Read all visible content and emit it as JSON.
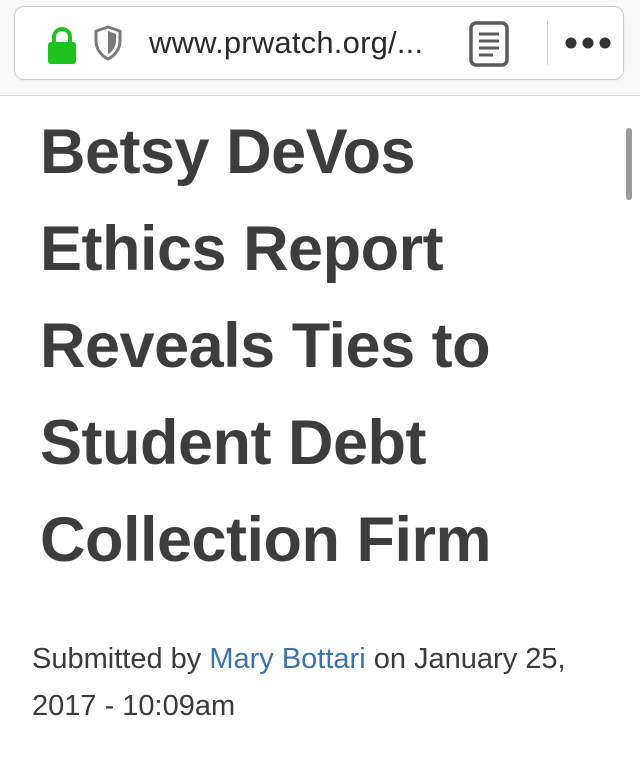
{
  "browser": {
    "url": "www.prwatch.org/...",
    "icons": {
      "lock": "lock-icon",
      "shield": "tracking-protection-shield-icon",
      "reader": "reader-view-icon",
      "more": "more-options-icon"
    },
    "colors": {
      "lock": "#1ec41e",
      "shield": "#7a7a7a"
    }
  },
  "article": {
    "title": "Betsy DeVos Ethics Report Reveals Ties to Student Debt Collection Firm",
    "byline": {
      "prefix": "Submitted by",
      "author": "Mary Bottari",
      "date_prefix": "on",
      "date": "January 25, 2017 - 10:09am"
    },
    "colors": {
      "title": "#3d3d3d",
      "link": "#3a72b0"
    }
  }
}
